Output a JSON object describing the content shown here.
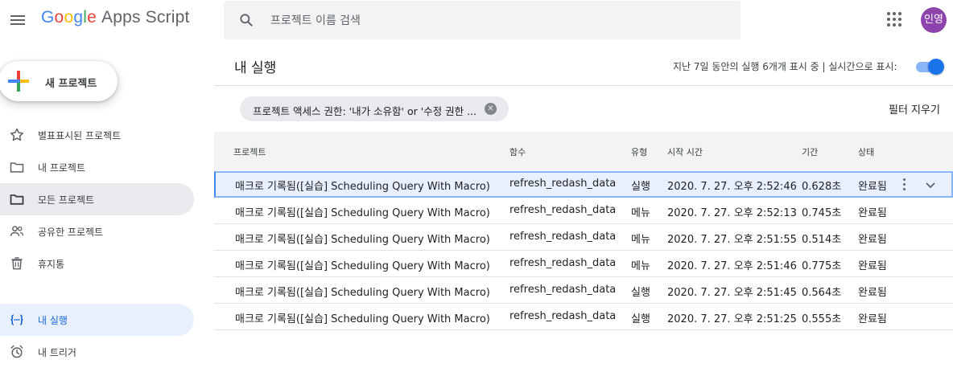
{
  "header": {
    "logo_google": [
      "G",
      "o",
      "o",
      "g",
      "l",
      "e"
    ],
    "logo_google_colors": [
      "#4285f4",
      "#ea4335",
      "#fbbc05",
      "#4285f4",
      "#34a853",
      "#ea4335"
    ],
    "logo_product": "Apps Script",
    "search_placeholder": "프로젝트 이름 검색",
    "avatar_text": "인영",
    "avatar_color": "#8e44ad"
  },
  "sidebar": {
    "new_project_label": "새 프로젝트",
    "items": [
      {
        "label": "별표표시된 프로젝트",
        "icon": "star-icon"
      },
      {
        "label": "내 프로젝트",
        "icon": "folder-icon"
      },
      {
        "label": "모든 프로젝트",
        "icon": "folder-filled-icon"
      },
      {
        "label": "공유한 프로젝트",
        "icon": "people-icon"
      },
      {
        "label": "휴지통",
        "icon": "trash-icon"
      },
      {
        "label": "내 실행",
        "icon": "executions-icon"
      },
      {
        "label": "내 트리거",
        "icon": "alarm-icon"
      }
    ]
  },
  "main": {
    "title": "내 실행",
    "summary": "지난 7일 동안의 실행 6개개 표시 중   |   실시간으로 표시:",
    "realtime_on": true,
    "filter_chip": "프로젝트 액세스 권한: '내가 소유함' or '수정 권한 ...",
    "clear_filters": "필터 지우기"
  },
  "table": {
    "headers": [
      "프로젝트",
      "함수",
      "유형",
      "시작 시간",
      "기간",
      "상태"
    ],
    "rows": [
      [
        "매크로 기록됨([실습] Scheduling Query With Macro)",
        "refresh_redash_data",
        "실행",
        "2020. 7. 27. 오후 2:52:46",
        "0.628초",
        "완료됨"
      ],
      [
        "매크로 기록됨([실습] Scheduling Query With Macro)",
        "refresh_redash_data",
        "메뉴",
        "2020. 7. 27. 오후 2:52:13",
        "0.745초",
        "완료됨"
      ],
      [
        "매크로 기록됨([실습] Scheduling Query With Macro)",
        "refresh_redash_data",
        "메뉴",
        "2020. 7. 27. 오후 2:51:55",
        "0.514초",
        "완료됨"
      ],
      [
        "매크로 기록됨([실습] Scheduling Query With Macro)",
        "refresh_redash_data",
        "메뉴",
        "2020. 7. 27. 오후 2:51:46",
        "0.775초",
        "완료됨"
      ],
      [
        "매크로 기록됨([실습] Scheduling Query With Macro)",
        "refresh_redash_data",
        "실행",
        "2020. 7. 27. 오후 2:51:45",
        "0.564초",
        "완료됨"
      ],
      [
        "매크로 기록됨([실습] Scheduling Query With Macro)",
        "refresh_redash_data",
        "실행",
        "2020. 7. 27. 오후 2:51:25",
        "0.555초",
        "완료됨"
      ]
    ]
  },
  "colors": {
    "accent": "#1a73e8",
    "selected_row": "#e8f0fe",
    "active_nav": "#e8f0fe"
  }
}
